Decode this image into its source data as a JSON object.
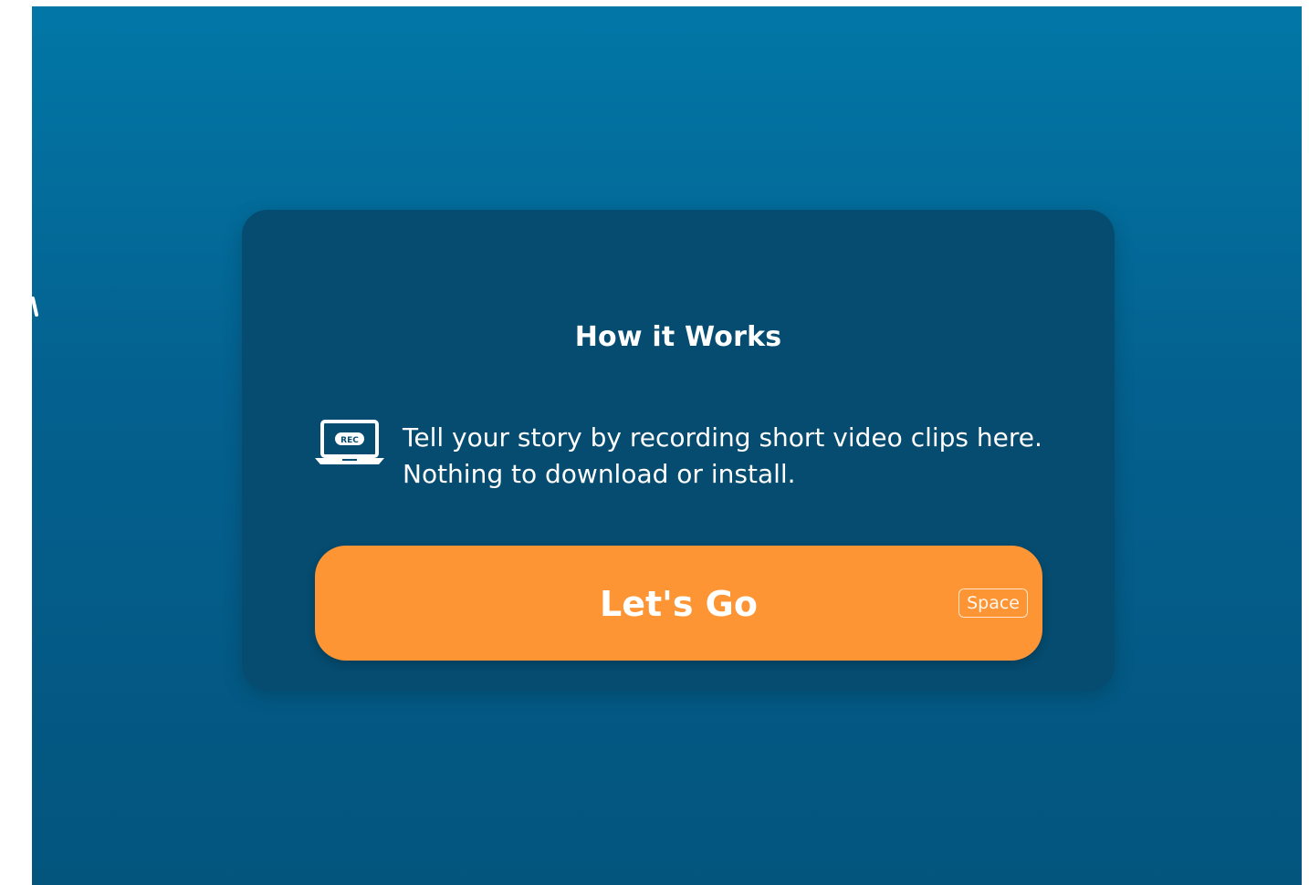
{
  "how_it_works": {
    "title": "How it Works",
    "icon": "laptop-rec-icon",
    "icon_badge": "REC",
    "line_1": "Tell your story by recording short video clips here.",
    "line_2": "Nothing to download or install."
  },
  "start_button": {
    "label": "Let's Go",
    "shortcut": "Space"
  },
  "colors": {
    "background_top": "#0277a7",
    "background_bottom": "#03557e",
    "card": "#054c70",
    "button": "#fd9534",
    "text": "#ffffff"
  }
}
